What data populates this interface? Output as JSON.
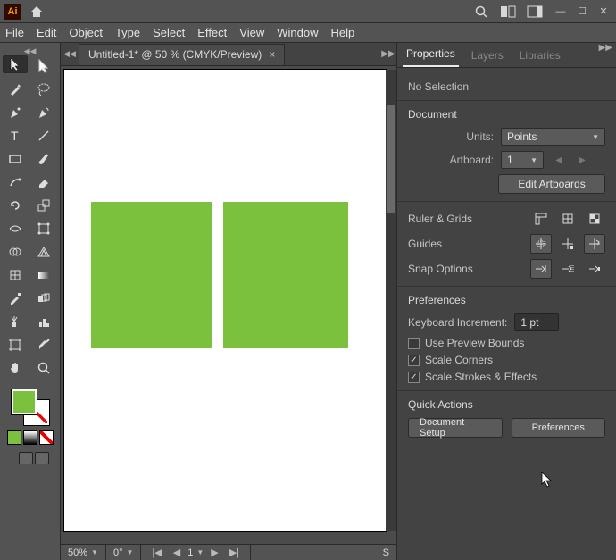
{
  "app": {
    "badge": "Ai"
  },
  "window_buttons": {
    "min": "—",
    "max": "☐",
    "close": "✕"
  },
  "menubar": [
    "File",
    "Edit",
    "Object",
    "Type",
    "Select",
    "Effect",
    "View",
    "Window",
    "Help"
  ],
  "doc_tab": {
    "title": "Untitled-1* @ 50 % (CMYK/Preview)",
    "close": "×"
  },
  "statusbar": {
    "zoom": "50%",
    "rotation": "0°",
    "artboard": "1",
    "s": "S"
  },
  "panel": {
    "tabs": {
      "properties": "Properties",
      "layers": "Layers",
      "libraries": "Libraries"
    },
    "no_selection": "No Selection",
    "document": "Document",
    "units_label": "Units:",
    "units_value": "Points",
    "artboard_label": "Artboard:",
    "artboard_value": "1",
    "edit_artboards": "Edit Artboards",
    "ruler_grids": "Ruler & Grids",
    "guides": "Guides",
    "snap_options": "Snap Options",
    "preferences": "Preferences",
    "ki_label": "Keyboard Increment:",
    "ki_value": "1 pt",
    "cb_preview": "Use Preview Bounds",
    "cb_scale_corners": "Scale Corners",
    "cb_scale_strokes": "Scale Strokes & Effects",
    "quick_actions": "Quick Actions",
    "doc_setup": "Document Setup",
    "prefs_btn": "Preferences"
  },
  "colors": {
    "shape_fill": "#7cc13e"
  }
}
